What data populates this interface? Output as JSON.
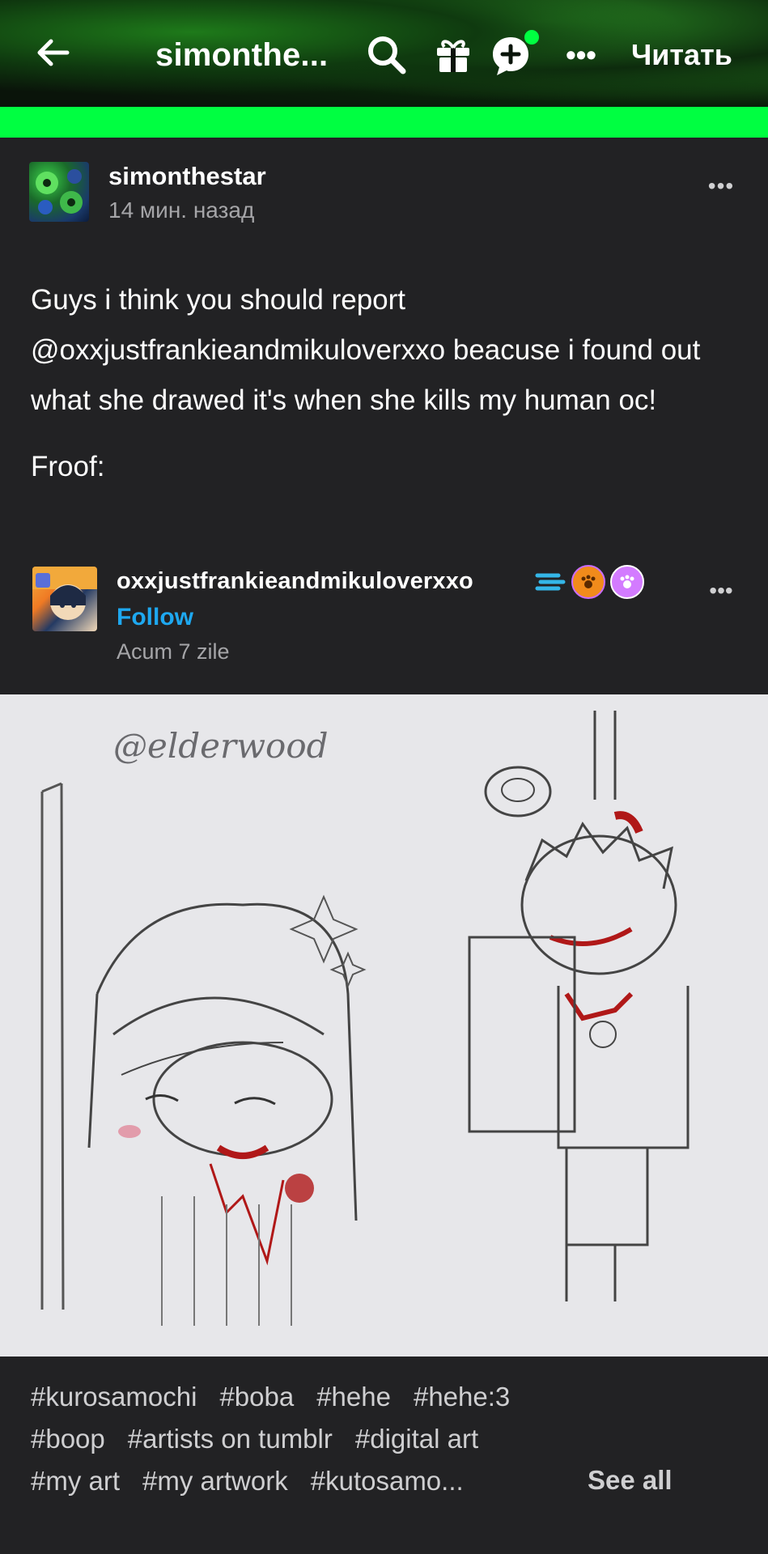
{
  "header": {
    "blog_title": "simonthe...",
    "read_label": "Читать",
    "more_label": "•••",
    "icons": {
      "back": "back-arrow-icon",
      "search": "search-icon",
      "gift": "gift-icon",
      "chat": "chat-add-icon"
    },
    "accent_color": "#00ff41"
  },
  "post": {
    "author": "simonthestar",
    "time": "14 мин. назад",
    "more_label": "•••",
    "body_paragraph_1": "Guys i think you should report @oxxjustfrankieandmikuloverxxo beacuse i found out what she drawed it's when she kills my human oc!",
    "body_paragraph_2": "Froof:"
  },
  "reblog": {
    "author": "oxxjustfrankieandmikuloverxxo",
    "follow_label": "Follow",
    "time": "Acum 7 zile",
    "more_label": "•••",
    "follow_color": "#1ea8f0"
  },
  "artwork": {
    "signature": "@elderwood"
  },
  "tags": {
    "row1": [
      "#kurosamochi",
      "#boba",
      "#hehe",
      "#hehe:3"
    ],
    "row2": [
      "#boop",
      "#artists on tumblr",
      "#digital art"
    ],
    "row3": [
      "#my art",
      "#my artwork",
      "#kutosamo..."
    ],
    "see_all_label": "See all"
  }
}
